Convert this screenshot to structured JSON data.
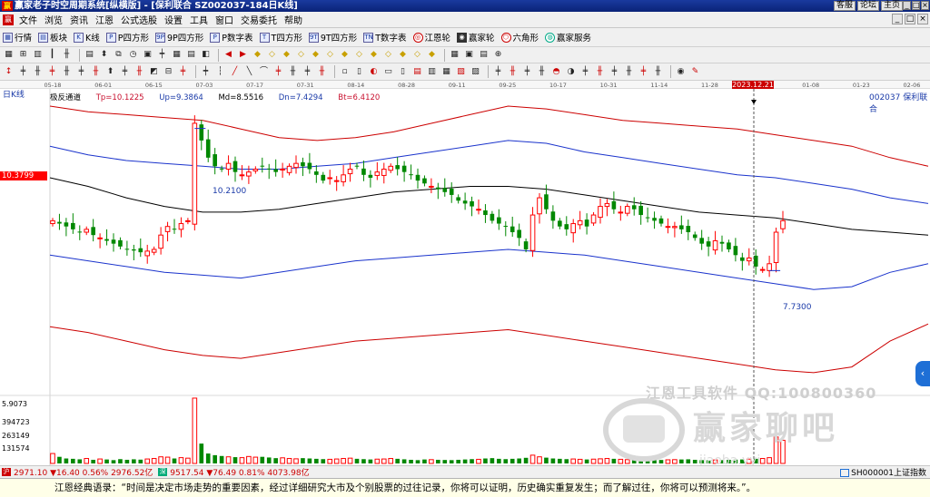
{
  "window": {
    "title": "赢家老子时空周期系统[纵横版] - [保利联合  SZ002037-184日K线]",
    "links": [
      "客服",
      "论坛",
      "主页"
    ],
    "controls": [
      "_",
      "□",
      "×"
    ]
  },
  "menu": {
    "items": [
      "文件",
      "浏览",
      "资讯",
      "江恩",
      "公式选股",
      "设置",
      "工具",
      "窗口",
      "交易委托",
      "帮助"
    ]
  },
  "toolbar1": {
    "items": [
      "行情",
      "板块",
      "K线",
      "P四方形",
      "9P四方形",
      "P数字表",
      "T四方形",
      "9T四方形",
      "T数字表",
      "江恩轮",
      "赢家轮",
      "六角形",
      "赢家服务"
    ]
  },
  "date_ruler": {
    "labels": [
      "05-18",
      "06-01",
      "06-15",
      "07-03",
      "07-17",
      "07-31",
      "08-14",
      "08-28",
      "09-11",
      "09-25",
      "10-17",
      "10-31",
      "11-14",
      "11-28",
      "12-12",
      "01-08",
      "01-23",
      "02-06"
    ],
    "marker": "2023.12.21"
  },
  "indicator": {
    "name": "极反通道",
    "tp": "Tp=10.1225",
    "up": "Up=9.3864",
    "md": "Md=8.5516",
    "dn": "Dn=7.4294",
    "bt": "Bt=6.4120"
  },
  "period": "日K线",
  "stock": "002037  保利联合",
  "price_tag": "10.3799",
  "high_label": "10.2100",
  "low_label": "7.7300",
  "volume_axis": [
    "5.9073",
    "394723",
    "263149",
    "131574"
  ],
  "watermark": {
    "line1": "江恩工具软件  QQ:100800360",
    "brand": "赢家聊吧"
  },
  "index_bar": {
    "sh": "2971.10 ▼16.40 0.56% 2976.52亿",
    "sz": "9517.54 ▼76.49 0.81% 4073.98亿",
    "right": "SH000001上证指数"
  },
  "quote": "江恩经典语录：“时间是决定市场走势的重要因素，经过详细研究大市及个别股票的过往记录，你将可以证明，历史确实重复发生；而了解过往，你将可以预测将来。”。",
  "colors": {
    "title_bar": "#0a2378",
    "up_candle": "#ff0000",
    "down_candle": "#008800",
    "outer_band": "#cc0000",
    "inner_band": "#1a33cc",
    "mid_line": "#000000"
  },
  "chart_data": {
    "type": "candlestick",
    "x_labels": [
      "05-18",
      "06-01",
      "06-15",
      "07-03",
      "07-17",
      "07-31",
      "08-14",
      "08-28",
      "09-11",
      "09-25",
      "10-17",
      "10-31",
      "11-14",
      "11-28",
      "12-12",
      "01-08",
      "01-23",
      "02-06"
    ],
    "price_range": [
      5.6,
      10.9
    ],
    "volume_range": [
      0,
      400000
    ],
    "close_series": [
      8.6,
      8.55,
      8.5,
      8.45,
      8.4,
      8.45,
      8.35,
      8.3,
      8.25,
      8.2,
      8.15,
      8.1,
      8.08,
      8.05,
      8.07,
      8.1,
      8.35,
      8.5,
      8.45,
      8.55,
      8.6,
      10.3,
      10.0,
      9.7,
      9.55,
      9.5,
      9.6,
      9.45,
      9.4,
      9.45,
      9.5,
      9.55,
      9.5,
      9.45,
      9.5,
      9.55,
      9.6,
      9.55,
      9.5,
      9.4,
      9.3,
      9.35,
      9.3,
      9.4,
      9.5,
      9.55,
      9.4,
      9.35,
      9.45,
      9.5,
      9.55,
      9.5,
      9.45,
      9.4,
      9.3,
      9.25,
      9.2,
      9.15,
      9.1,
      9.05,
      8.95,
      8.9,
      8.85,
      8.8,
      8.7,
      8.6,
      8.55,
      8.5,
      8.4,
      8.3,
      8.1,
      8.7,
      9.0,
      8.8,
      8.6,
      8.5,
      8.45,
      8.55,
      8.6,
      8.5,
      8.7,
      8.85,
      8.9,
      8.8,
      8.75,
      8.85,
      8.8,
      8.7,
      8.65,
      8.6,
      8.55,
      8.5,
      8.5,
      8.45,
      8.4,
      8.3,
      8.2,
      8.15,
      8.25,
      8.2,
      8.1,
      8.0,
      7.9,
      7.95,
      7.8,
      7.75,
      7.85,
      8.4,
      8.6
    ],
    "volume_series": [
      60000,
      40000,
      30000,
      28000,
      25000,
      30000,
      22000,
      27000,
      24000,
      20000,
      26000,
      22000,
      25000,
      23000,
      27000,
      30000,
      40000,
      38000,
      30000,
      35000,
      32000,
      394723,
      120000,
      60000,
      50000,
      45000,
      40000,
      38000,
      35000,
      42000,
      38000,
      40000,
      36000,
      32000,
      34000,
      30000,
      28000,
      32000,
      30000,
      28000,
      26000,
      25000,
      27000,
      30000,
      32000,
      28000,
      26000,
      24000,
      26000,
      27000,
      30000,
      28000,
      25000,
      22000,
      20000,
      24000,
      23000,
      22000,
      21000,
      20000,
      22000,
      24000,
      26000,
      25000,
      30000,
      32000,
      28000,
      26000,
      28000,
      30000,
      34000,
      50000,
      40000,
      35000,
      30000,
      28000,
      26000,
      27000,
      25000,
      24000,
      26000,
      28000,
      30000,
      28000,
      25000,
      23000,
      22000,
      24000,
      22000,
      20000,
      21000,
      22000,
      23000,
      24000,
      25000,
      22000,
      20000,
      19000,
      21000,
      20000,
      22000,
      23000,
      24000,
      26000,
      28000,
      30000,
      35000,
      160000,
      140000
    ],
    "bands": {
      "tp": [
        10.6,
        10.5,
        10.45,
        10.4,
        10.35,
        10.2,
        10.05,
        10.0,
        10.05,
        10.15,
        10.3,
        10.45,
        10.6,
        10.55,
        10.45,
        10.35,
        10.3,
        10.25,
        10.2,
        10.1,
        10.0,
        9.9,
        9.7,
        9.55
      ],
      "up": [
        9.9,
        9.75,
        9.65,
        9.6,
        9.55,
        9.5,
        9.5,
        9.55,
        9.6,
        9.7,
        9.8,
        9.9,
        10.0,
        9.95,
        9.8,
        9.7,
        9.6,
        9.5,
        9.4,
        9.35,
        9.25,
        9.15,
        9.0,
        8.9
      ],
      "md": [
        9.35,
        9.2,
        9.0,
        8.85,
        8.75,
        8.75,
        8.8,
        8.9,
        9.0,
        9.1,
        9.15,
        9.2,
        9.2,
        9.15,
        9.05,
        8.95,
        8.85,
        8.75,
        8.7,
        8.65,
        8.55,
        8.45,
        8.4,
        8.35
      ],
      "dn": [
        8.0,
        7.9,
        7.8,
        7.7,
        7.65,
        7.6,
        7.7,
        7.8,
        7.9,
        7.95,
        8.0,
        8.05,
        8.1,
        8.05,
        8.0,
        7.9,
        7.8,
        7.7,
        7.6,
        7.5,
        7.4,
        7.45,
        7.7,
        7.85
      ],
      "bt": [
        6.75,
        6.65,
        6.5,
        6.35,
        6.25,
        6.2,
        6.3,
        6.4,
        6.5,
        6.55,
        6.6,
        6.65,
        6.7,
        6.6,
        6.5,
        6.4,
        6.3,
        6.2,
        6.1,
        6.0,
        5.95,
        6.05,
        6.5,
        6.8
      ]
    }
  }
}
